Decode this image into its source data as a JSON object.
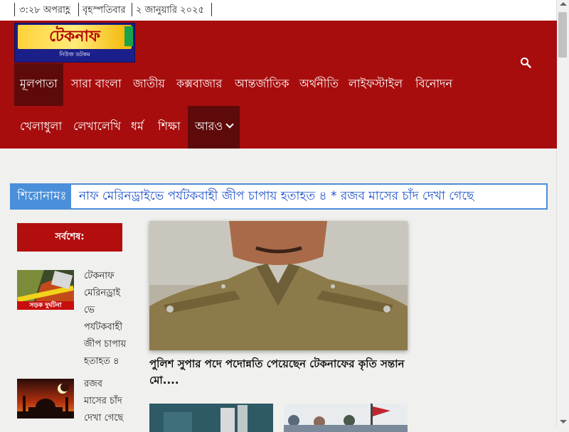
{
  "topbar": {
    "time": "৩:২৮ অপরাহ্ণ",
    "day": "বৃহস্পতিবার",
    "date": "২ জানুয়ারি ২০২৫"
  },
  "logo": {
    "title": "টেকনাফ",
    "subtitle": "নিউজ ডটকম"
  },
  "search": {
    "icon": "search-icon"
  },
  "nav": {
    "row1": [
      "মূলপাতা",
      "সারা বাংলা",
      "জাতীয়",
      "কক্সবাজার",
      "আন্তর্জাতিক",
      "অর্থনীতি",
      "লাইফস্টাইল",
      "বিনোদন"
    ],
    "row2": [
      "খেলাধুলা",
      "লেখালেখি",
      "ধর্ম",
      "শিক্ষা",
      "আরও"
    ]
  },
  "ticker": {
    "label": "শিরোনামঃ",
    "text": "নাফ মেরিনড্রাইভে পর্যটকবাহী জীপ চাপায় হতাহত ৪    *    রজব মাসের চাঁদ দেখা গেছে"
  },
  "sidebar": {
    "heading": "সর্বশেষ:",
    "items": [
      {
        "title": "টেকনাফ মেরিনড্রাই ভে পর্যটকবাহী জীপ চাপায় হতাহত ৪",
        "thumb_text": "সড়ক দুর্ঘটনা"
      },
      {
        "title": "রজব মাসের চাঁদ দেখা গেছে"
      }
    ]
  },
  "main_story": {
    "title": "পুলিশ সুপার পদে পদোন্নতি পেয়েছেন টেকনাফের কৃতি সন্তান মো...."
  },
  "colors": {
    "header_red": "#a80d0d",
    "nav_active": "#5e0a0a",
    "ticker_blue": "#4a8fd9",
    "ticker_text": "#1c4fc9"
  }
}
